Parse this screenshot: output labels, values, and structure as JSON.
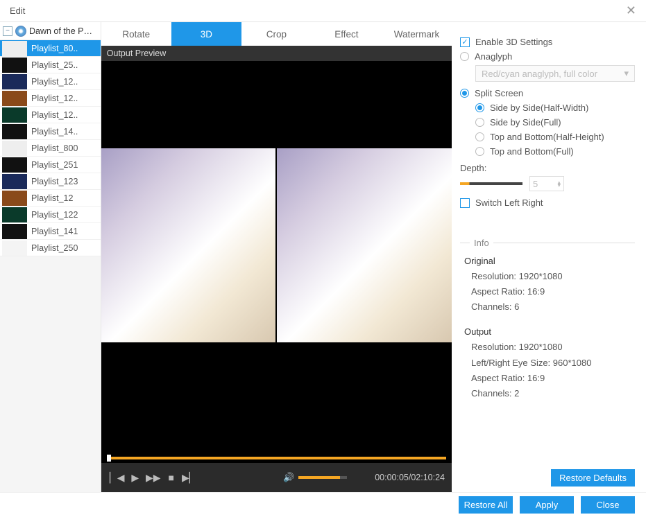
{
  "header": {
    "title": "Edit",
    "close": "✕"
  },
  "sidebar": {
    "source_name": "Dawn of the P…",
    "items": [
      {
        "label": "Playlist_80..",
        "thumb": "#eee"
      },
      {
        "label": "Playlist_25..",
        "thumb": "#111"
      },
      {
        "label": "Playlist_12..",
        "thumb": "#1a2a5a"
      },
      {
        "label": "Playlist_12..",
        "thumb": "#8a4a1a"
      },
      {
        "label": "Playlist_12..",
        "thumb": "#0a3a2a"
      },
      {
        "label": "Playlist_14..",
        "thumb": "#111"
      },
      {
        "label": "Playlist_800",
        "thumb": "#eee"
      },
      {
        "label": "Playlist_251",
        "thumb": "#111"
      },
      {
        "label": "Playlist_123",
        "thumb": "#1a2a5a"
      },
      {
        "label": "Playlist_12",
        "thumb": "#8a4a1a"
      },
      {
        "label": "Playlist_122",
        "thumb": "#0a3a2a"
      },
      {
        "label": "Playlist_141",
        "thumb": "#111"
      },
      {
        "label": "Playlist_250",
        "thumb": "#f4f4f4"
      }
    ],
    "selected_index": 0
  },
  "tabs": {
    "items": [
      "Rotate",
      "3D",
      "Crop",
      "Effect",
      "Watermark"
    ],
    "active": 1
  },
  "preview": {
    "label": "Output Preview"
  },
  "playback": {
    "time": "00:00:05/02:10:24"
  },
  "settings3d": {
    "enable_label": "Enable 3D Settings",
    "enable": true,
    "anaglyph_label": "Anaglyph",
    "anaglyph_option": "Red/cyan anaglyph, full color",
    "split_label": "Split Screen",
    "mode": "split",
    "split_options": [
      "Side by Side(Half-Width)",
      "Side by Side(Full)",
      "Top and Bottom(Half-Height)",
      "Top and Bottom(Full)"
    ],
    "split_selected": 0,
    "depth_label": "Depth:",
    "depth_value": "5",
    "switch_label": "Switch Left Right"
  },
  "info": {
    "heading": "Info",
    "original": {
      "title": "Original",
      "resolution": "Resolution: 1920*1080",
      "aspect": "Aspect Ratio: 16:9",
      "channels": "Channels: 6"
    },
    "output": {
      "title": "Output",
      "resolution": "Resolution: 1920*1080",
      "eye": "Left/Right Eye Size: 960*1080",
      "aspect": "Aspect Ratio: 16:9",
      "channels": "Channels: 2"
    }
  },
  "buttons": {
    "restore_defaults": "Restore Defaults",
    "restore_all": "Restore All",
    "apply": "Apply",
    "close": "Close"
  }
}
